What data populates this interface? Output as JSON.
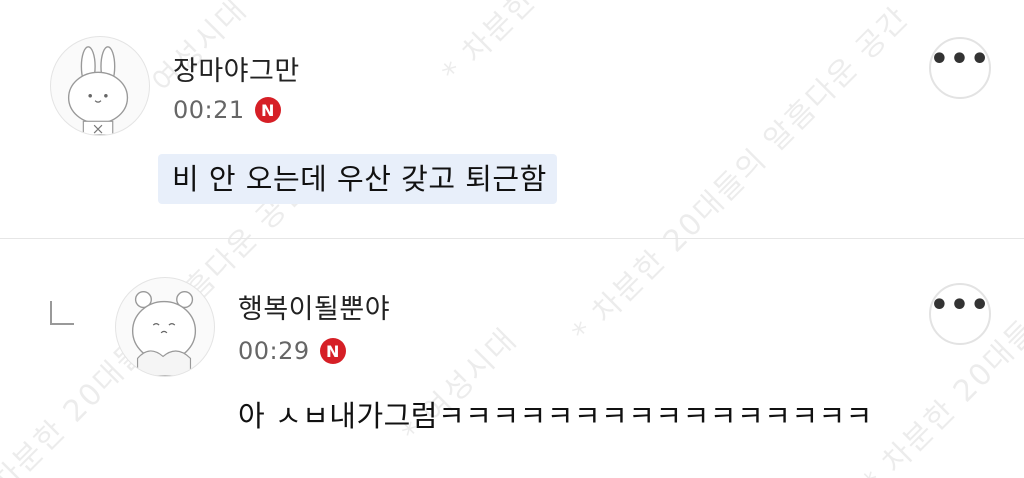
{
  "watermark": {
    "text_a": "여성시대",
    "text_b": "차분한 20대들의 알흠다운 공간",
    "star": "*"
  },
  "comments": [
    {
      "author": "장마야그만",
      "time": "00:21",
      "badge": "N",
      "content": "비 안 오는데 우산 갖고 퇴근함",
      "highlighted": true,
      "avatar": "rabbit-avatar",
      "more_label": "•••"
    },
    {
      "author": "행복이될뿐야",
      "time": "00:29",
      "badge": "N",
      "content": "아 ㅅㅂ내가그럼ㅋㅋㅋㅋㅋㅋㅋㅋㅋㅋㅋㅋㅋㅋㅋㅋ",
      "is_reply": true,
      "avatar": "bear-avatar",
      "more_label": "•••"
    }
  ],
  "colors": {
    "badge": "#d61f26",
    "highlight": "#e8effa",
    "divider": "#e6e6e6"
  }
}
